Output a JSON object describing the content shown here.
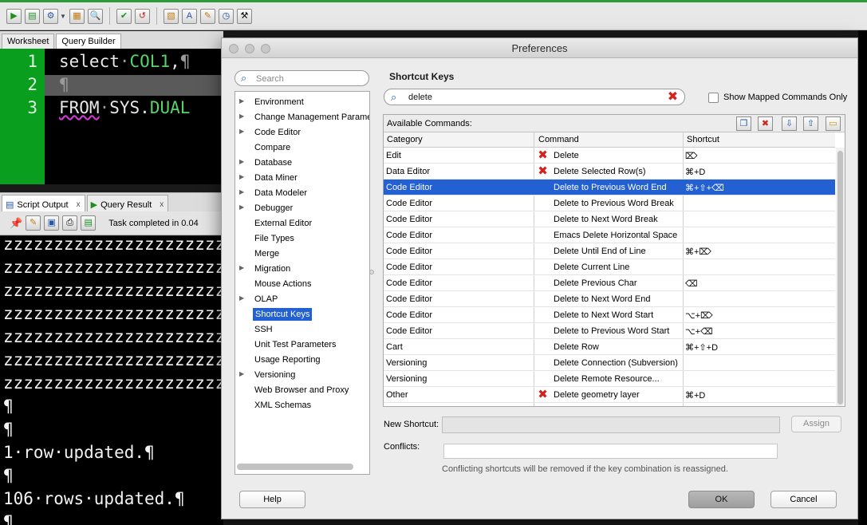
{
  "dialog": {
    "title": "Preferences",
    "left_search_placeholder": "Search",
    "tree": [
      {
        "label": "Environment",
        "expandable": true
      },
      {
        "label": "Change Management Paramete",
        "expandable": true
      },
      {
        "label": "Code Editor",
        "expandable": true
      },
      {
        "label": "Compare",
        "expandable": false
      },
      {
        "label": "Database",
        "expandable": true
      },
      {
        "label": "Data Miner",
        "expandable": true
      },
      {
        "label": "Data Modeler",
        "expandable": true
      },
      {
        "label": "Debugger",
        "expandable": true
      },
      {
        "label": "External Editor",
        "expandable": false
      },
      {
        "label": "File Types",
        "expandable": false
      },
      {
        "label": "Merge",
        "expandable": false
      },
      {
        "label": "Migration",
        "expandable": true
      },
      {
        "label": "Mouse Actions",
        "expandable": false
      },
      {
        "label": "OLAP",
        "expandable": true
      },
      {
        "label": "Shortcut Keys",
        "expandable": false,
        "selected": true
      },
      {
        "label": "SSH",
        "expandable": false
      },
      {
        "label": "Unit Test Parameters",
        "expandable": false
      },
      {
        "label": "Usage Reporting",
        "expandable": false
      },
      {
        "label": "Versioning",
        "expandable": true
      },
      {
        "label": "Web Browser and Proxy",
        "expandable": false
      },
      {
        "label": "XML Schemas",
        "expandable": false
      }
    ],
    "shortcut_keys": {
      "title": "Shortcut Keys",
      "search_value": "delete",
      "show_mapped_label": "Show Mapped Commands Only",
      "available_label": "Available Commands:",
      "columns": [
        "Category",
        "Command",
        "Shortcut"
      ],
      "rows": [
        {
          "category": "Edit",
          "command": "Delete",
          "shortcut": "⌦",
          "icon": "delete-x-icon"
        },
        {
          "category": "Data Editor",
          "command": "Delete Selected Row(s)",
          "shortcut": "⌘+D",
          "icon": "delete-x-icon"
        },
        {
          "category": "Code Editor",
          "command": "Delete to Previous Word End",
          "shortcut": "⌘+⇧+⌫",
          "selected": true
        },
        {
          "category": "Code Editor",
          "command": "Delete to Previous Word Break",
          "shortcut": ""
        },
        {
          "category": "Code Editor",
          "command": "Delete to Next Word Break",
          "shortcut": ""
        },
        {
          "category": "Code Editor",
          "command": "Emacs Delete Horizontal Space",
          "shortcut": ""
        },
        {
          "category": "Code Editor",
          "command": "Delete Until End of Line",
          "shortcut": "⌘+⌦"
        },
        {
          "category": "Code Editor",
          "command": "Delete Current Line",
          "shortcut": ""
        },
        {
          "category": "Code Editor",
          "command": "Delete Previous Char",
          "shortcut": "⌫"
        },
        {
          "category": "Code Editor",
          "command": "Delete to Next Word End",
          "shortcut": ""
        },
        {
          "category": "Code Editor",
          "command": "Delete to Next Word Start",
          "shortcut": "⌥+⌦"
        },
        {
          "category": "Code Editor",
          "command": "Delete to Previous Word Start",
          "shortcut": "⌥+⌫"
        },
        {
          "category": "Cart",
          "command": "Delete Row",
          "shortcut": "⌘+⇧+D"
        },
        {
          "category": "Versioning",
          "command": "Delete Connection (Subversion)",
          "shortcut": ""
        },
        {
          "category": "Versioning",
          "command": "Delete Remote Resource...",
          "shortcut": ""
        },
        {
          "category": "Other",
          "command": "Delete geometry layer",
          "shortcut": "⌘+D",
          "icon": "delete-x-icon"
        }
      ],
      "new_shortcut_label": "New Shortcut:",
      "new_shortcut_value": "",
      "assign_label": "Assign",
      "conflicts_label": "Conflicts:",
      "conflicts_value": "",
      "conflict_note": "Conflicting shortcuts will be removed if the key combination is reassigned."
    },
    "buttons": {
      "help": "Help",
      "ok": "OK",
      "cancel": "Cancel"
    }
  },
  "worksheet": {
    "tabs": [
      "Worksheet",
      "Query Builder"
    ],
    "lines": [
      "1",
      "2",
      "3"
    ]
  },
  "output": {
    "tabs": [
      {
        "label": "Script Output",
        "close": "x"
      },
      {
        "label": "Query Result",
        "close": "x"
      }
    ],
    "task_text": "Task completed in 0.04",
    "lines": [
      "zzzzzzzzzzzzzzzzzzzzzz",
      "zzzzzzzzzzzzzzzzzzzzzz",
      "zzzzzzzzzzzzzzzzzzzzzz",
      "zzzzzzzzzzzzzzzzzzzzzz",
      "zzzzzzzzzzzzzzzzzzzzzz",
      "zzzzzzzzzzzzzzzzzzzzzz",
      "zzzzzzzzzzzzzzzzzzzzzz",
      "¶",
      "¶",
      "1·row·updated.¶",
      "¶",
      "106·rows·updated.¶",
      "¶"
    ]
  },
  "colors": {
    "accent": "#2360d2",
    "gutter": "#0a9e1e",
    "delete_icon": "#d4231d"
  }
}
